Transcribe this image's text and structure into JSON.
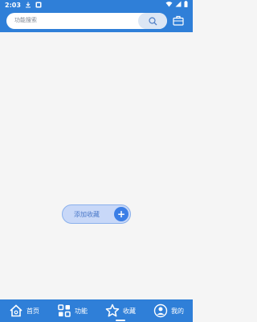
{
  "status_bar": {
    "time": "2:03",
    "icons": [
      "download-icon",
      "notification-icon",
      "wifi-icon",
      "signal-icon",
      "battery-icon"
    ]
  },
  "header": {
    "search_placeholder": "功能搜索",
    "search_button_icon": "search-icon",
    "right_icon": "briefcase-icon"
  },
  "main": {
    "add_favorite_label": "添加收藏",
    "add_favorite_icon": "plus-icon"
  },
  "tab_bar": {
    "items": [
      {
        "label": "首页",
        "icon": "home-icon"
      },
      {
        "label": "功能",
        "icon": "grid-icon"
      },
      {
        "label": "收藏",
        "icon": "star-icon",
        "selected": true
      },
      {
        "label": "我的",
        "icon": "user-icon"
      }
    ]
  },
  "colors": {
    "primary": "#2f7fd8",
    "background": "#f5f5f5",
    "button_fill": "#c8d8f8",
    "accent": "#3b7ee6"
  }
}
